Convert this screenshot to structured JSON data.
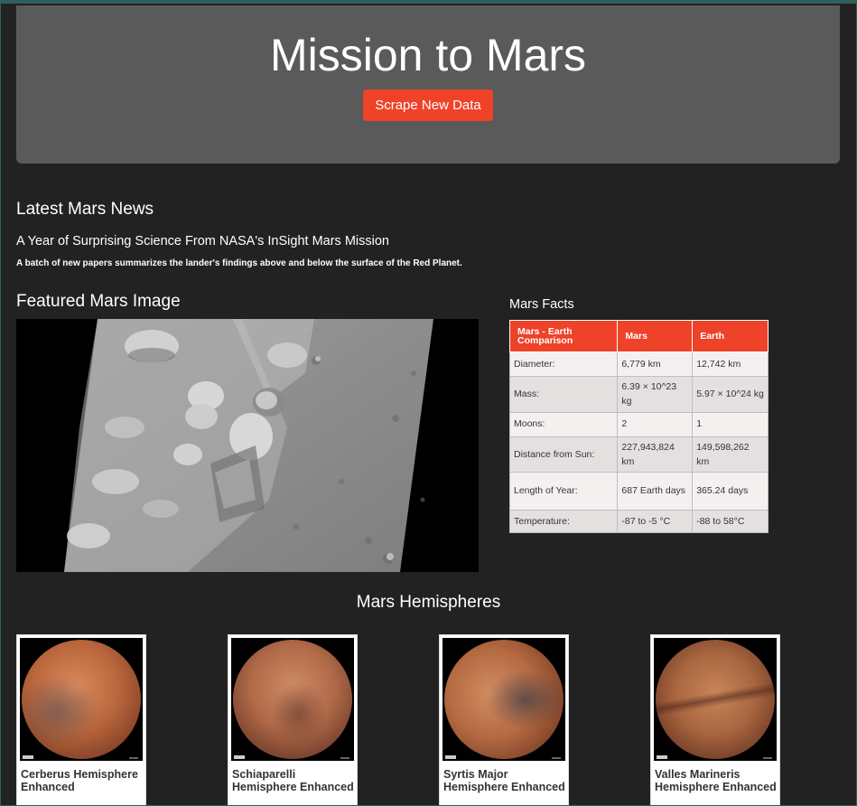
{
  "header": {
    "title": "Mission to Mars",
    "scrape_button": "Scrape New Data"
  },
  "news": {
    "heading": "Latest Mars News",
    "title": "A Year of Surprising Science From NASA's InSight Mars Mission",
    "paragraph": "A batch of new papers summarizes the lander's findings above and below the surface of the Red Planet."
  },
  "featured_image": {
    "heading": "Featured Mars Image"
  },
  "facts": {
    "heading": "Mars Facts",
    "columns": [
      "Mars - Earth Comparison",
      "Mars",
      "Earth"
    ],
    "rows": [
      [
        "Diameter:",
        "6,779 km",
        "12,742 km"
      ],
      [
        "Mass:",
        "6.39 × 10^23 kg",
        "5.97 × 10^24 kg"
      ],
      [
        "Moons:",
        "2",
        "1"
      ],
      [
        "Distance from Sun:",
        "227,943,824 km",
        "149,598,262 km"
      ],
      [
        "Length of Year:",
        "687 Earth days",
        "365.24 days"
      ],
      [
        "Temperature:",
        "-87 to -5 °C",
        "-88 to 58°C"
      ]
    ]
  },
  "hemispheres": {
    "heading": "Mars Hemispheres",
    "items": [
      {
        "title": "Cerberus Hemisphere Enhanced"
      },
      {
        "title": "Schiaparelli Hemisphere Enhanced"
      },
      {
        "title": "Syrtis Major Hemisphere Enhanced"
      },
      {
        "title": "Valles Marineris Hemisphere Enhanced"
      }
    ]
  },
  "colors": {
    "accent": "#ee4229",
    "background": "#222222",
    "jumbotron": "#5a5a5a"
  }
}
